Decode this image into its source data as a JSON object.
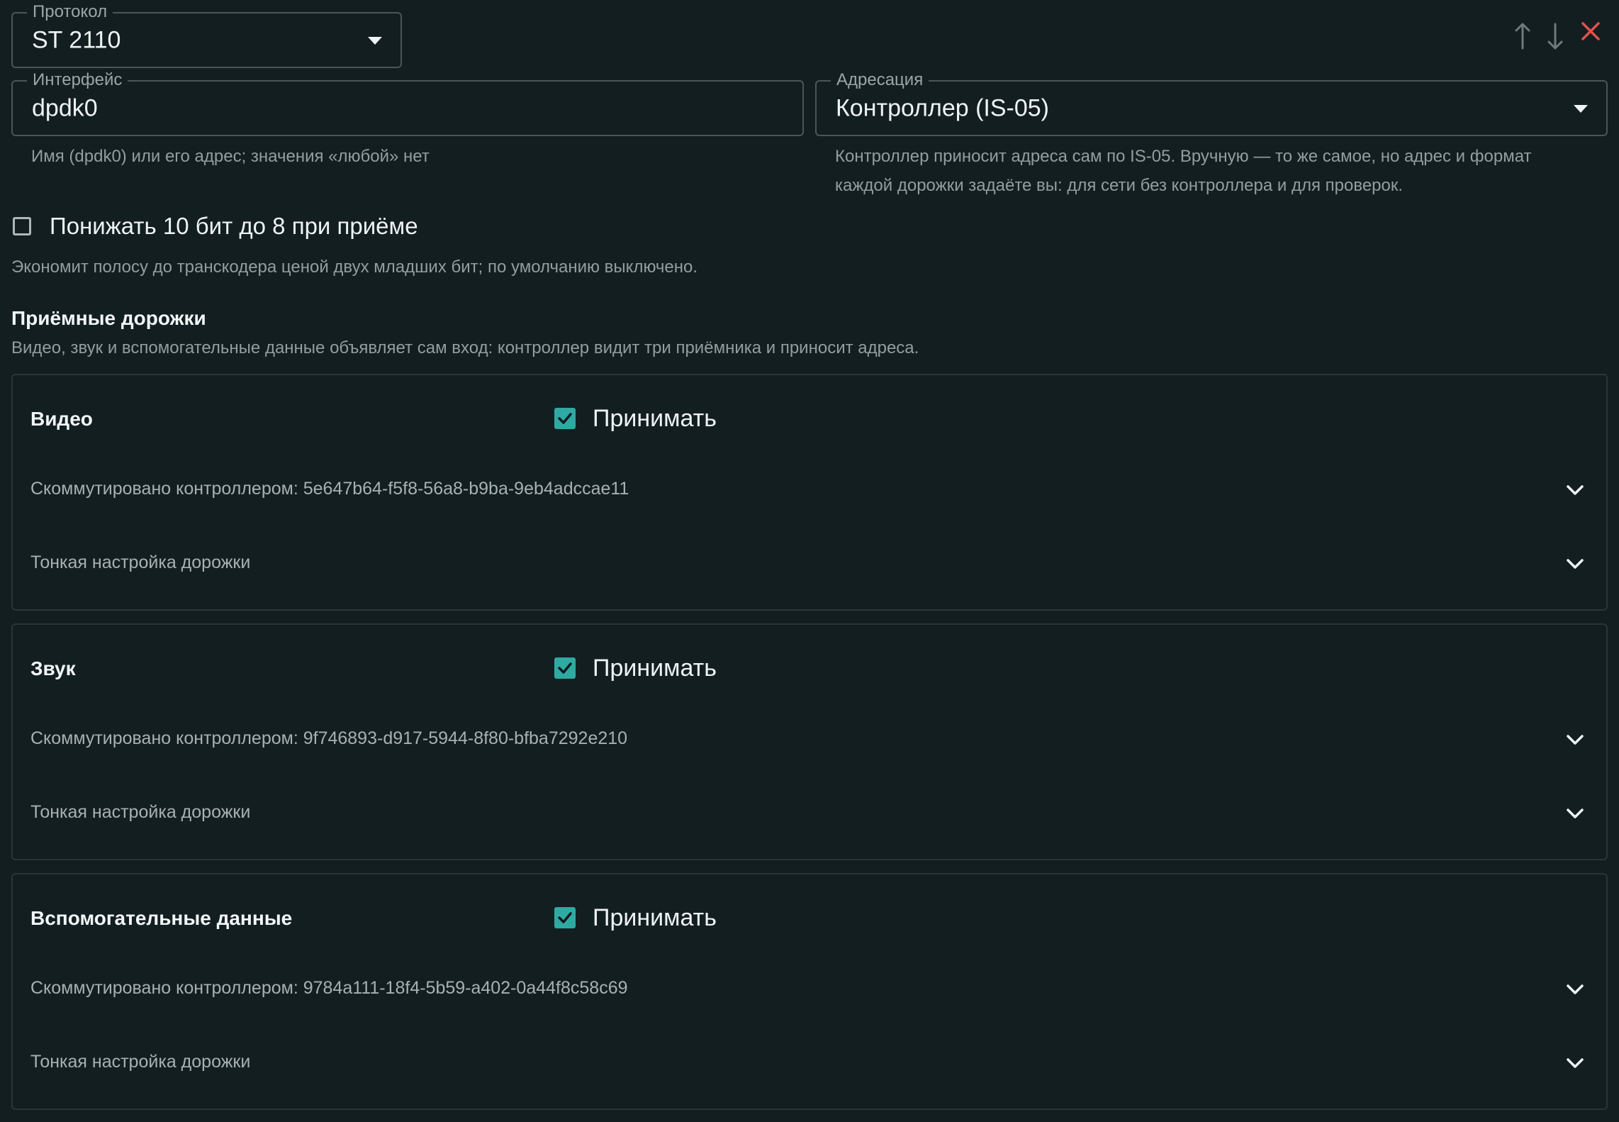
{
  "protocol": {
    "legend": "Протокол",
    "value": "ST 2110"
  },
  "interface": {
    "legend": "Интерфейс",
    "value": "dpdk0",
    "helper": "Имя (dpdk0) или его адрес; значения «любой» нет"
  },
  "addressing": {
    "legend": "Адресация",
    "value": "Контроллер (IS-05)",
    "helper_line1": "Контроллер приносит адреса сам по IS-05. Вручную — то же самое, но адрес и формат",
    "helper_line2": "каждой дорожки задаёте вы: для сети без контроллера и для проверок."
  },
  "downconvert": {
    "label": "Понижать 10 бит до 8 при приёме",
    "checked": false,
    "helper": "Экономит полосу до транскодера ценой двух младших бит; по умолчанию выключено."
  },
  "tracks_section": {
    "title": "Приёмные дорожки",
    "subtitle": "Видео, звук и вспомогательные данные объявляет сам вход: контроллер видит три приёмника и приносит адреса."
  },
  "tracks": [
    {
      "title": "Видео",
      "accept_label": "Принимать",
      "accept_checked": true,
      "routed": "Скоммутировано контроллером: 5e647b64-f5f8-56a8-b9ba-9eb4adccae11",
      "tuning": "Тонкая настройка дорожки"
    },
    {
      "title": "Звук",
      "accept_label": "Принимать",
      "accept_checked": true,
      "routed": "Скоммутировано контроллером: 9f746893-d917-5944-8f80-bfba7292e210",
      "tuning": "Тонкая настройка дорожки"
    },
    {
      "title": "Вспомогательные данные",
      "accept_label": "Принимать",
      "accept_checked": true,
      "routed": "Скоммутировано контроллером: 9784a111-18f4-5b59-a402-0a44f8c58c69",
      "tuning": "Тонкая настройка дорожки"
    }
  ],
  "colors": {
    "background": "#131e20",
    "accent": "#2eaaa3",
    "danger": "#e0524c",
    "border": "#4a5658"
  },
  "icons": {
    "move_up": "arrow-up-icon",
    "move_down": "arrow-down-icon",
    "remove": "close-icon",
    "expand": "chevron-down-icon",
    "dropdown": "caret-down-icon"
  }
}
